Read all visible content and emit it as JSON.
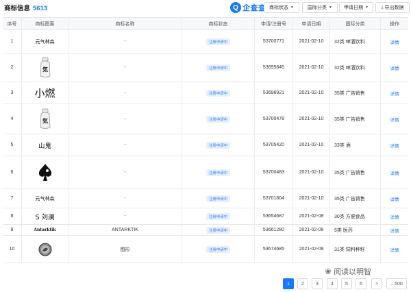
{
  "header": {
    "title": "商标信息",
    "count": "5613",
    "logo_mark": "Q",
    "logo_text": "企查查",
    "filters": [
      {
        "label": "商标状态"
      },
      {
        "label": "国际分类"
      },
      {
        "label": "申请日期"
      }
    ],
    "export_label": "导出数据"
  },
  "table": {
    "columns": [
      "序号",
      "商标图案",
      "商标名称",
      "商标状态",
      "申请/注册号",
      "申请日期",
      "国际分类",
      "操作"
    ],
    "rows": [
      {
        "seq": "1",
        "mark_text": "元气林森",
        "mark_type": "text",
        "name": "-",
        "status": "注册申请中",
        "reg": "53700771",
        "date": "2021-02-10",
        "class": "32类 啤酒饮料",
        "op": "详情"
      },
      {
        "seq": "2",
        "mark_text": "",
        "mark_type": "bottle",
        "name": "-",
        "status": "注册申请中",
        "reg": "53695845",
        "date": "2021-02-10",
        "class": "32类 啤酒饮料",
        "op": "详情"
      },
      {
        "seq": "3",
        "mark_text": "小燃",
        "mark_type": "big",
        "name": "-",
        "status": "注册申请中",
        "reg": "53696921",
        "date": "2021-02-10",
        "class": "35类 广告销售",
        "op": "详情"
      },
      {
        "seq": "4",
        "mark_text": "",
        "mark_type": "bottle",
        "name": "-",
        "status": "注册申请中",
        "reg": "53700478",
        "date": "2021-02-10",
        "class": "35类 广告销售",
        "op": "详情"
      },
      {
        "seq": "5",
        "mark_text": "山鬼",
        "mark_type": "mid",
        "name": "-",
        "status": "注册申请中",
        "reg": "53705420",
        "date": "2021-02-10",
        "class": "33类 酒",
        "op": "详情"
      },
      {
        "seq": "6",
        "mark_text": "",
        "mark_type": "spade",
        "name": "-",
        "status": "注册申请中",
        "reg": "53700483",
        "date": "2021-02-10",
        "class": "35类 广告销售",
        "op": "详情"
      },
      {
        "seq": "7",
        "mark_text": "元气林森",
        "mark_type": "text",
        "name": "-",
        "status": "注册申请中",
        "reg": "53701804",
        "date": "2021-02-10",
        "class": "35类 广告销售",
        "op": "详情"
      },
      {
        "seq": "8",
        "mark_text": "S 刘澜",
        "mark_type": "mid",
        "name": "-",
        "status": "注册申请中",
        "reg": "53654687",
        "date": "2021-02-08",
        "class": "30类 方便食品",
        "op": "详情"
      },
      {
        "seq": "9",
        "mark_text": "Antarktik",
        "mark_type": "serif",
        "name": "ANTARKTIK",
        "status": "注册申请中",
        "reg": "53661280",
        "date": "2021-02-08",
        "class": "5类 医药",
        "op": "详情"
      },
      {
        "seq": "10",
        "mark_text": "",
        "mark_type": "circle",
        "name": "图形",
        "status": "注册申请中",
        "reg": "53674685",
        "date": "2021-02-08",
        "class": "31类 饲料种籽",
        "op": "详情"
      }
    ]
  },
  "pagination": {
    "pages": [
      "1",
      "2",
      "3",
      "4",
      "5",
      "6"
    ],
    "active": "1",
    "next": ">",
    "last": "...500"
  },
  "watermark": {
    "text": "阅读以明智"
  }
}
